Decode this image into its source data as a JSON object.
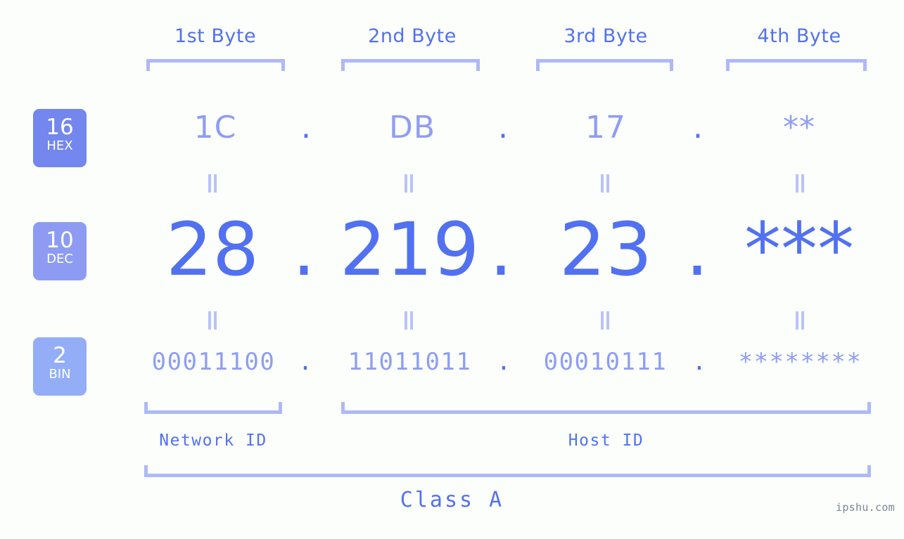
{
  "meta": {
    "background": "#fcfefb",
    "accent": "#5271f0",
    "accent_light": "#8e9ef3",
    "bracket_color": "#aeb9f7",
    "watermark": "ipshu.com"
  },
  "byte_headers": [
    {
      "label": "1st Byte"
    },
    {
      "label": "2nd Byte"
    },
    {
      "label": "3rd Byte"
    },
    {
      "label": "4th Byte"
    }
  ],
  "rows": [
    {
      "badge_number": "16",
      "badge_name": "HEX",
      "badge_color": "#7487ee",
      "values": [
        "1C",
        "DB",
        "17",
        "**"
      ],
      "separator": "."
    },
    {
      "badge_number": "10",
      "badge_name": "DEC",
      "badge_color": "#8d9cf2",
      "values": [
        "28",
        "219",
        "23",
        "***"
      ],
      "separator": "."
    },
    {
      "badge_number": "2",
      "badge_name": "BIN",
      "badge_color": "#93adf6",
      "values": [
        "00011100",
        "11011011",
        "00010111",
        "********"
      ],
      "separator": "."
    }
  ],
  "equals_marker": "=",
  "id_sections": [
    {
      "label": "Network ID"
    },
    {
      "label": "Host ID"
    }
  ],
  "class_label": "Class A"
}
